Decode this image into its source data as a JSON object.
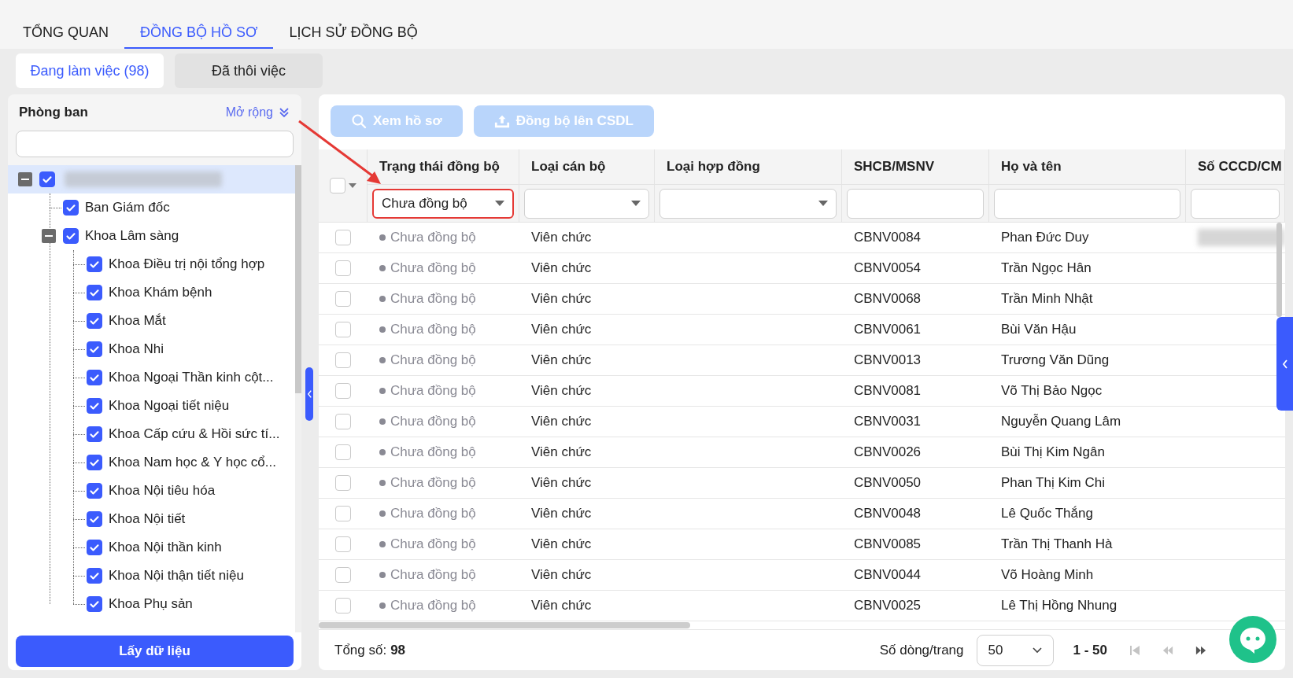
{
  "tabs": [
    {
      "label": "TỔNG QUAN",
      "selected": false
    },
    {
      "label": "ĐỒNG BỘ HỒ SƠ",
      "selected": true
    },
    {
      "label": "LỊCH SỬ ĐỒNG BỘ",
      "selected": false
    }
  ],
  "subtabs": [
    {
      "label": "Đang làm việc (98)",
      "selected": true
    },
    {
      "label": "Đã thôi việc",
      "selected": false
    }
  ],
  "department_panel": {
    "title": "Phòng ban",
    "expand_link": "Mở rộng",
    "fetch_button": "Lấy dữ liệu",
    "tree": [
      {
        "redacted": true,
        "checked": true,
        "selected": true,
        "expanded": true,
        "children": [
          {
            "label": "Ban Giám đốc",
            "checked": true,
            "selected": false
          },
          {
            "label": "Khoa Lâm sàng",
            "checked": true,
            "selected": false,
            "expanded": true,
            "children": [
              {
                "label": "Khoa Điều trị nội tổng hợp",
                "checked": true,
                "selected": false
              },
              {
                "label": "Khoa Khám bệnh",
                "checked": true,
                "selected": false
              },
              {
                "label": "Khoa Mắt",
                "checked": true,
                "selected": false
              },
              {
                "label": "Khoa Nhi",
                "checked": true,
                "selected": false
              },
              {
                "label": "Khoa Ngoại Thần kinh cột...",
                "checked": true,
                "selected": false
              },
              {
                "label": "Khoa Ngoại tiết niệu",
                "checked": true,
                "selected": false
              },
              {
                "label": "Khoa Cấp cứu & Hồi sức tí...",
                "checked": true,
                "selected": false
              },
              {
                "label": "Khoa Nam học & Y học cổ...",
                "checked": true,
                "selected": false
              },
              {
                "label": "Khoa Nội tiêu hóa",
                "checked": true,
                "selected": false
              },
              {
                "label": "Khoa Nội tiết",
                "checked": true,
                "selected": false
              },
              {
                "label": "Khoa Nội thần kinh",
                "checked": true,
                "selected": false
              },
              {
                "label": "Khoa Nội thận tiết niệu",
                "checked": true,
                "selected": false
              },
              {
                "label": "Khoa Phụ sản",
                "checked": true,
                "selected": false
              }
            ]
          }
        ]
      }
    ]
  },
  "toolbar": [
    {
      "kind": "search",
      "label": "Xem hồ sơ",
      "disabled": true
    },
    {
      "kind": "upload",
      "label": "Đồng bộ lên CSDL",
      "disabled": true
    }
  ],
  "table": {
    "select_all": {
      "checked": false
    },
    "columns": [
      {
        "label": "Trạng thái đồng bộ",
        "filter": {
          "kind": "select",
          "value": "Chưa đồng bộ",
          "highlighted": true
        }
      },
      {
        "label": "Loại cán bộ",
        "filter": {
          "kind": "select",
          "highlighted": false
        }
      },
      {
        "label": "Loại hợp đồng",
        "filter": {
          "kind": "select",
          "highlighted": false
        }
      },
      {
        "label": "SHCB/MSNV",
        "filter": {
          "kind": "text",
          "highlighted": false
        }
      },
      {
        "label": "Họ và tên",
        "filter": {
          "kind": "text",
          "highlighted": false
        }
      },
      {
        "label": "Số CCCD/CM",
        "filter": {
          "kind": "text",
          "highlighted": false
        }
      }
    ],
    "rows": [
      {
        "checked": false,
        "status": "Chưa đồng bộ",
        "staff_type": "Viên chức",
        "code": "CBNV0084",
        "name": "Phan Đức Duy",
        "id_redacted": true
      },
      {
        "checked": false,
        "status": "Chưa đồng bộ",
        "staff_type": "Viên chức",
        "code": "CBNV0054",
        "name": "Trần Ngọc Hân",
        "id_redacted": false
      },
      {
        "checked": false,
        "status": "Chưa đồng bộ",
        "staff_type": "Viên chức",
        "code": "CBNV0068",
        "name": "Trần Minh Nhật",
        "id_redacted": false
      },
      {
        "checked": false,
        "status": "Chưa đồng bộ",
        "staff_type": "Viên chức",
        "code": "CBNV0061",
        "name": "Bùi Văn Hậu",
        "id_redacted": false
      },
      {
        "checked": false,
        "status": "Chưa đồng bộ",
        "staff_type": "Viên chức",
        "code": "CBNV0013",
        "name": "Trương Văn Dũng",
        "id_redacted": false
      },
      {
        "checked": false,
        "status": "Chưa đồng bộ",
        "staff_type": "Viên chức",
        "code": "CBNV0081",
        "name": "Võ Thị Bảo Ngọc",
        "id_redacted": false
      },
      {
        "checked": false,
        "status": "Chưa đồng bộ",
        "staff_type": "Viên chức",
        "code": "CBNV0031",
        "name": "Nguyễn Quang Lâm",
        "id_redacted": false
      },
      {
        "checked": false,
        "status": "Chưa đồng bộ",
        "staff_type": "Viên chức",
        "code": "CBNV0026",
        "name": "Bùi Thị Kim Ngân",
        "id_redacted": false
      },
      {
        "checked": false,
        "status": "Chưa đồng bộ",
        "staff_type": "Viên chức",
        "code": "CBNV0050",
        "name": "Phan Thị Kim Chi",
        "id_redacted": false
      },
      {
        "checked": false,
        "status": "Chưa đồng bộ",
        "staff_type": "Viên chức",
        "code": "CBNV0048",
        "name": "Lê Quốc Thắng",
        "id_redacted": false
      },
      {
        "checked": false,
        "status": "Chưa đồng bộ",
        "staff_type": "Viên chức",
        "code": "CBNV0085",
        "name": "Trần Thị Thanh Hà",
        "id_redacted": false
      },
      {
        "checked": false,
        "status": "Chưa đồng bộ",
        "staff_type": "Viên chức",
        "code": "CBNV0044",
        "name": "Võ Hoàng Minh",
        "id_redacted": false
      },
      {
        "checked": false,
        "status": "Chưa đồng bộ",
        "staff_type": "Viên chức",
        "code": "CBNV0025",
        "name": "Lê Thị Hồng Nhung",
        "id_redacted": false
      }
    ]
  },
  "footer": {
    "total_label": "Tổng số:",
    "total": "98",
    "rows_per_page_label": "Số dòng/trang",
    "rows_per_page": "50",
    "range": "1 - 50",
    "pager": [
      {
        "kind": "first",
        "disabled": true
      },
      {
        "kind": "prev",
        "disabled": true
      },
      {
        "kind": "next",
        "disabled": false
      }
    ]
  }
}
